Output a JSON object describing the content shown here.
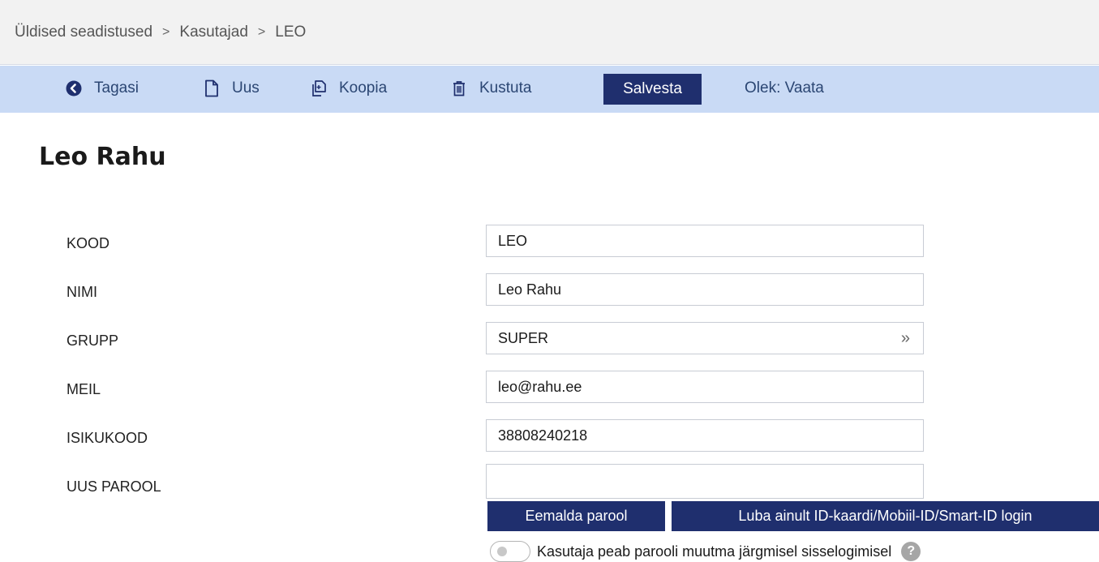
{
  "breadcrumb": {
    "items": [
      "Üldised seadistused",
      "Kasutajad",
      "LEO"
    ],
    "separator": ">"
  },
  "toolbar": {
    "back_label": "Tagasi",
    "new_label": "Uus",
    "copy_label": "Koopia",
    "delete_label": "Kustuta",
    "save_label": "Salvesta",
    "status_label": "Olek: Vaata",
    "accent_color": "#1f2f6e",
    "background_color": "#c9daf5"
  },
  "page": {
    "title": "Leo Rahu"
  },
  "form": {
    "fields": [
      {
        "label": "KOOD",
        "value": "LEO"
      },
      {
        "label": "NIMI",
        "value": "Leo Rahu"
      },
      {
        "label": "GRUPP",
        "value": "SUPER",
        "icon": "double-chevron-right-icon"
      },
      {
        "label": "MEIL",
        "value": "leo@rahu.ee"
      },
      {
        "label": "ISIKUKOOD",
        "value": "38808240218"
      },
      {
        "label": "UUS PAROOL",
        "value": ""
      }
    ],
    "remove_password_label": "Eemalda parool",
    "id_login_label": "Luba ainult ID-kaardi/Mobiil-ID/Smart-ID login",
    "must_change_password_label": "Kasutaja peab parooli muutma järgmisel sisselogimisel",
    "must_change_password_on": false,
    "help_icon": "?"
  }
}
